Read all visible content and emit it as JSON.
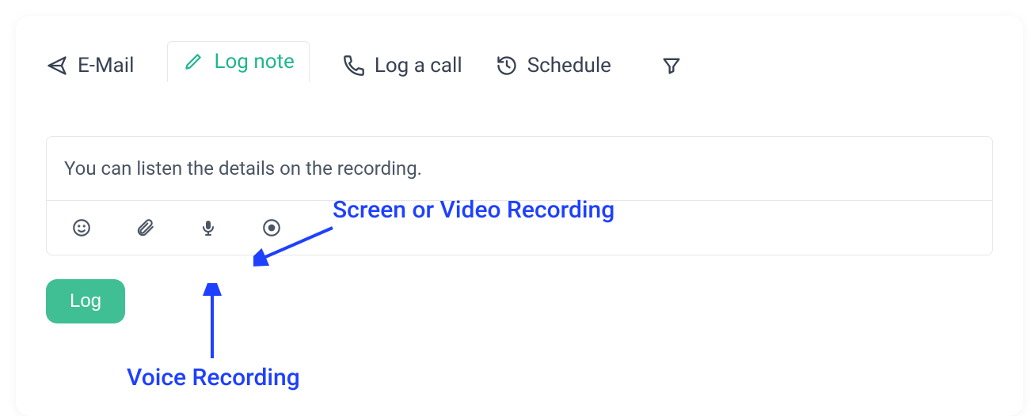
{
  "tabs": {
    "email": {
      "label": "E-Mail"
    },
    "log_note": {
      "label": "Log note",
      "active": true
    },
    "log_call": {
      "label": "Log a call"
    },
    "schedule": {
      "label": "Schedule"
    }
  },
  "composer": {
    "text": "You can listen the details on the recording.",
    "submit_label": "Log"
  },
  "annotations": {
    "screen_video": "Screen or Video Recording",
    "voice": "Voice Recording"
  }
}
